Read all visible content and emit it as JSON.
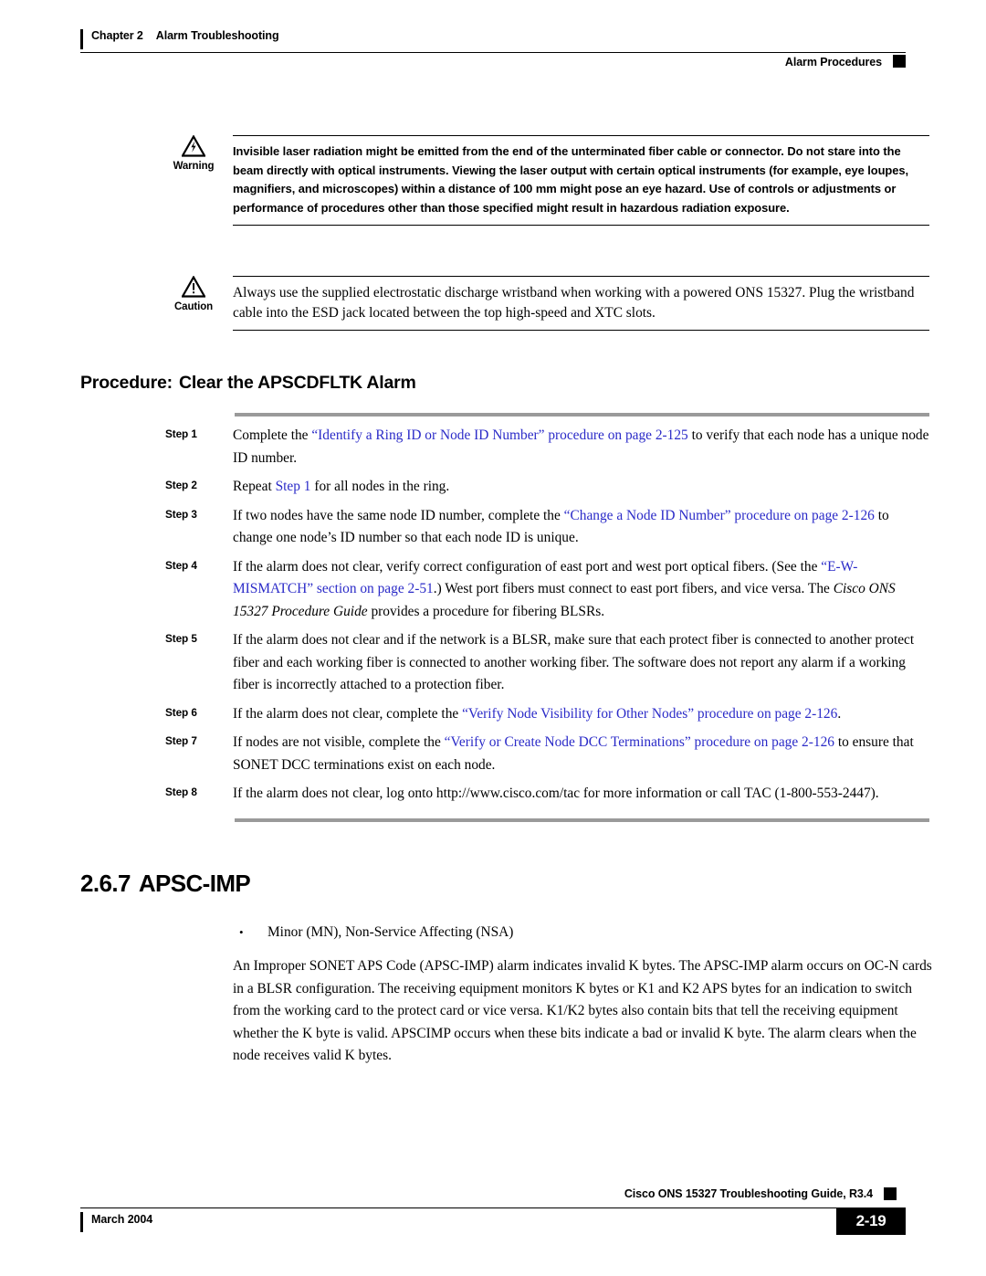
{
  "header": {
    "chapter": "Chapter 2",
    "chapter_title": "Alarm Troubleshooting",
    "running_head": "Alarm Procedures"
  },
  "warning": {
    "icon": "warning-laser-triangle-icon",
    "label": "Warning",
    "text": "Invisible laser radiation might be emitted from the end of the unterminated fiber cable or connector. Do not stare into the beam directly with optical instruments. Viewing the laser output with certain optical instruments (for example, eye loupes, magnifiers, and microscopes) within a distance of 100 mm might pose an eye hazard. Use of controls or adjustments or performance of procedures other than those specified might result in hazardous radiation exposure."
  },
  "caution": {
    "icon": "caution-triangle-icon",
    "label": "Caution",
    "text": "Always use the supplied electrostatic discharge wristband when working with a powered ONS 15327. Plug the wristband cable into the ESD jack located between the top high-speed and XTC slots."
  },
  "procedure": {
    "heading_prefix": "Procedure:",
    "heading_title": "Clear the APSCDFLTK Alarm",
    "steps": [
      {
        "label": "Step 1",
        "parts": [
          {
            "t": "Complete the ",
            "k": "plain"
          },
          {
            "t": "“Identify a Ring ID or Node ID Number” procedure on page 2-125",
            "k": "xref"
          },
          {
            "t": " to verify that each node has a unique node ID number.",
            "k": "plain"
          }
        ]
      },
      {
        "label": "Step 2",
        "parts": [
          {
            "t": "Repeat ",
            "k": "plain"
          },
          {
            "t": "Step 1",
            "k": "xref"
          },
          {
            "t": " for all nodes in the ring.",
            "k": "plain"
          }
        ]
      },
      {
        "label": "Step 3",
        "parts": [
          {
            "t": "If two nodes have the same node ID number, complete the ",
            "k": "plain"
          },
          {
            "t": "“Change a Node ID Number” procedure on page 2-126",
            "k": "xref"
          },
          {
            "t": " to change one node’s ID number so that each node ID is unique.",
            "k": "plain"
          }
        ]
      },
      {
        "label": "Step 4",
        "parts": [
          {
            "t": "If the alarm does not clear, verify correct configuration of east port and west port optical fibers. (See the ",
            "k": "plain"
          },
          {
            "t": "“E-W-MISMATCH” section on page 2-51",
            "k": "xref"
          },
          {
            "t": ".) West port fibers must connect to east port fibers, and vice versa. The ",
            "k": "plain"
          },
          {
            "t": "Cisco ONS 15327 Procedure Guide",
            "k": "ital"
          },
          {
            "t": " provides a procedure for fibering BLSRs.",
            "k": "plain"
          }
        ]
      },
      {
        "label": "Step 5",
        "parts": [
          {
            "t": "If the alarm does not clear and if the network is a BLSR, make sure that each protect fiber is connected to another protect fiber and each working fiber is connected to another working fiber. The software does not report any alarm if a working fiber is incorrectly attached to a protection fiber.",
            "k": "plain"
          }
        ]
      },
      {
        "label": "Step 6",
        "parts": [
          {
            "t": "If the alarm does not clear, complete the ",
            "k": "plain"
          },
          {
            "t": "“Verify Node Visibility for Other Nodes” procedure on page 2-126",
            "k": "xref"
          },
          {
            "t": ".",
            "k": "plain"
          }
        ]
      },
      {
        "label": "Step 7",
        "parts": [
          {
            "t": "If nodes are not visible, complete the ",
            "k": "plain"
          },
          {
            "t": "“Verify or Create Node DCC Terminations” procedure on page 2-126",
            "k": "xref"
          },
          {
            "t": " to ensure that SONET DCC terminations exist on each node.",
            "k": "plain"
          }
        ]
      },
      {
        "label": "Step 8",
        "parts": [
          {
            "t": "If the alarm does not clear, log onto http://www.cisco.com/tac for more information or call TAC (1-800-553-2447).",
            "k": "plain"
          }
        ]
      }
    ]
  },
  "section": {
    "number": "2.6.7",
    "title": "APSC-IMP",
    "bullet": "Minor (MN), Non-Service Affecting (NSA)",
    "paragraph": "An Improper SONET APS Code (APSC-IMP) alarm indicates invalid K bytes. The APSC-IMP alarm occurs on OC-N cards in a BLSR configuration. The receiving equipment monitors K bytes or K1 and K2 APS bytes for an indication to switch from the working card to the protect card or vice versa. K1/K2 bytes also contain bits that tell the receiving equipment whether the K byte is valid. APSCIMP occurs when these bits indicate a bad or invalid K byte. The alarm clears when the node receives valid K bytes."
  },
  "footer": {
    "doc_title": "Cisco ONS 15327 Troubleshooting Guide, R3.4",
    "date": "March 2004",
    "page_number": "2-19"
  },
  "colors": {
    "xref_blue": "#2b2bc8",
    "rule_grey": "#9a9a9a",
    "text_black": "#000000"
  }
}
